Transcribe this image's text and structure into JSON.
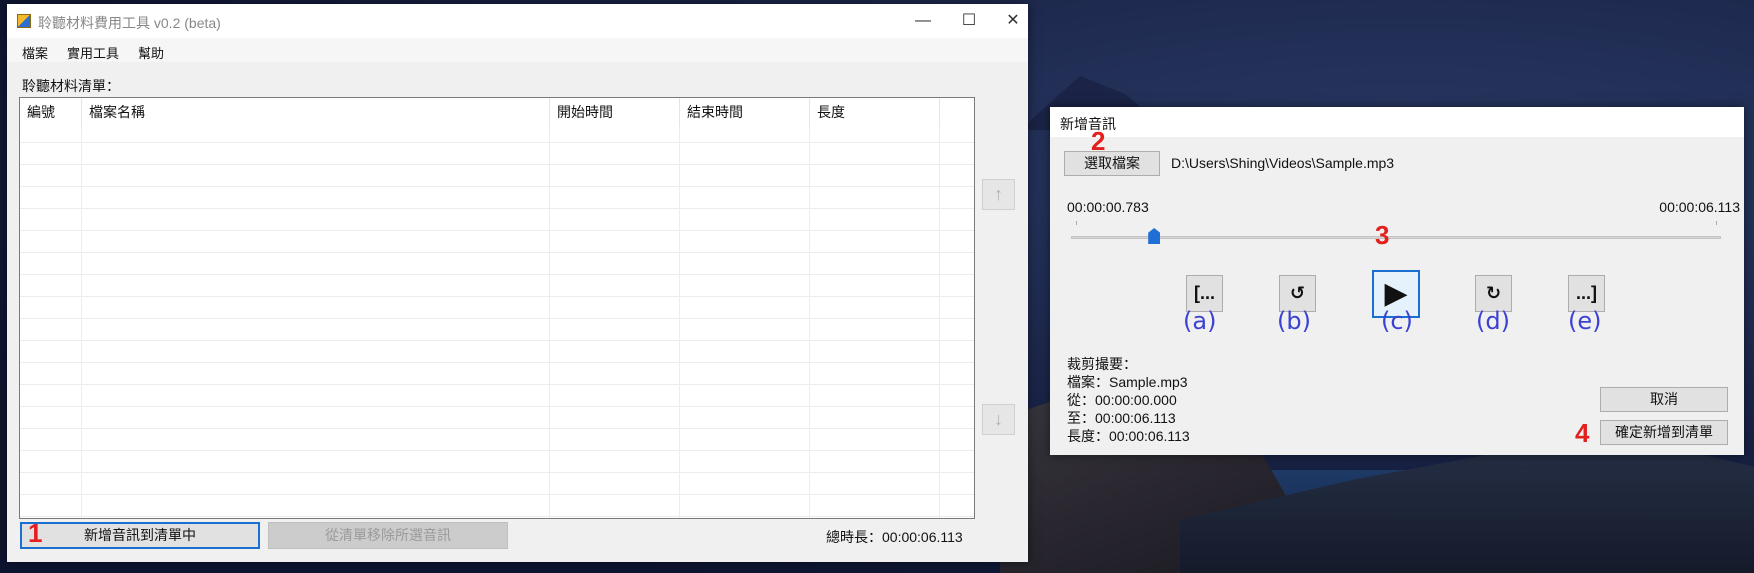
{
  "main_window": {
    "title": "聆聽材料費用工具 v0.2 (beta)",
    "menu": [
      "檔案",
      "實用工具",
      "幫助"
    ],
    "list_caption": "聆聽材料清單：",
    "columns": [
      "編號",
      "檔案名稱",
      "開始時間",
      "結束時間",
      "長度"
    ],
    "up_arrow": "↑",
    "down_arrow": "↓",
    "add_button": "新增音訊到清單中",
    "remove_button": "從清單移除所選音訊",
    "total_length": "總時長：00:00:06.113"
  },
  "dialog": {
    "title": "新增音訊",
    "choose_file_button": "選取檔案",
    "file_path": "D:\\Users\\Shing\\Videos\\Sample.mp3",
    "start_time": "00:00:00.783",
    "end_time": "00:00:06.113",
    "playback_position_fraction": 0.128,
    "controls": {
      "a": {
        "glyph": "[...",
        "label": "(a)"
      },
      "b": {
        "glyph": "↺",
        "label": "(b)"
      },
      "c": {
        "glyph": "▶",
        "label": "(c)"
      },
      "d": {
        "glyph": "↻",
        "label": "(d)"
      },
      "e": {
        "glyph": "...]",
        "label": "(e)"
      }
    },
    "summary": {
      "heading": "裁剪撮要：",
      "file": "檔案：Sample.mp3",
      "from": "從：00:00:00.000",
      "to": "至：00:00:06.113",
      "length": "長度：00:00:06.113"
    },
    "cancel_button": "取消",
    "confirm_button": "確定新增到清單"
  },
  "annotations": [
    "1",
    "2",
    "3",
    "4"
  ],
  "colors": {
    "accent": "#1a6fd0",
    "annotation": "#e2201e",
    "control_label": "#3b42d1"
  }
}
